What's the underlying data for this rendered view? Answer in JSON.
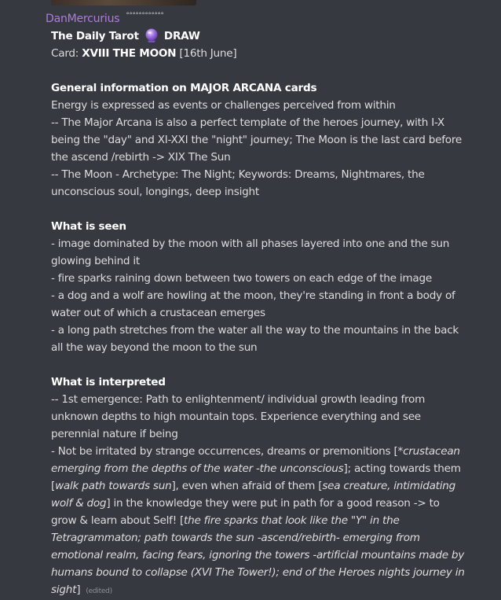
{
  "message": {
    "username": "DanMercurius",
    "username_decoration": "°°°°°°°°°°°°",
    "title_pre": "The Daily Tarot",
    "title_emoji_icon": "crystal-ball-icon",
    "title_post": "DRAW",
    "card_label": "Card:",
    "card_name": "XVIII THE MOON",
    "card_date": "[16th June]",
    "section1_heading": "General information on MAJOR ARCANA cards",
    "section1_lines": [
      "Energy is expressed as events or challenges perceived from within",
      "-- The Major Arcana is also a perfect template of the heroes journey, with I-X being the \"day\" and XI-XXI the \"night\" journey; The Moon is the last card before the ascend /rebirth -> XIX The Sun",
      "-- The Moon - Archetype: The Night; Keywords: Dreams, Nightmares, the unconscious soul, longings, deep insight"
    ],
    "section2_heading": "What is seen",
    "section2_lines": [
      "- image dominated by the moon with all phases layered into one and the sun glowing behind it",
      "- fire sparks raining down between two towers on each edge of the image",
      "- a dog and a wolf are howling at the moon, they're standing in front a body of water out of which a crustacean emerges",
      "- a long path stretches from the water all the way to the mountains in the back all the way beyond the moon to the sun"
    ],
    "section3_heading": "What is interpreted",
    "section3_line1": "-- 1st emergence: Path to enlightenment/ individual growth leading from unknown depths to high mountain tops. Experience everything and see perennial nature if being",
    "section3_line2": {
      "t1": "- Not be irritated by strange occurrences, dreams or premonitions [",
      "i1": "*crustacean emerging from the depths of the water -the unconscious",
      "t2": "]; acting towards them [",
      "i2": "walk path towards sun",
      "t3": "], even when afraid of them [",
      "i3": "sea creature, intimidating wolf & dog",
      "t4": "] in the knowledge they were put in path for a good reason -> to grow & learn about Self! [",
      "i4": "the fire sparks that look like the \"Y\" in the Tetragrammaton; path towards the sun -ascend/rebirth- emerging from emotional realm, facing fears, ignoring the towers -artificial mountains made by humans bound to collapse (XVI The Tower!); end of the Heroes nights journey in sight",
      "t5": "]"
    },
    "edited_label": "(edited)"
  }
}
